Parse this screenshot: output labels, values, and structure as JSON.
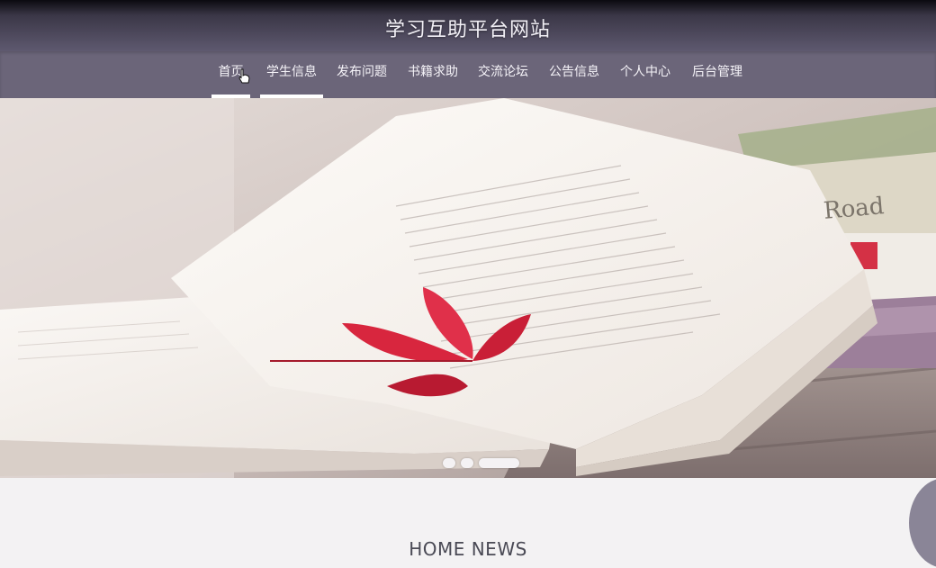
{
  "site": {
    "title": "学习互助平台网站"
  },
  "nav": {
    "items": [
      {
        "label": "首页"
      },
      {
        "label": "学生信息"
      },
      {
        "label": "发布问题"
      },
      {
        "label": "书籍求助"
      },
      {
        "label": "交流论坛"
      },
      {
        "label": "公告信息"
      },
      {
        "label": "个人中心"
      },
      {
        "label": "后台管理"
      }
    ],
    "active_index": 0
  },
  "banner": {
    "image": "open-book-with-red-leaf",
    "book_spine_text": "Road",
    "slides": 3,
    "current_slide": 3
  },
  "section": {
    "heading": "HOME NEWS"
  },
  "colors": {
    "header_dark": "#0b0a10",
    "nav_bg": "#6b6579",
    "page_bg": "#f3f2f3",
    "leaf_red": "#d8263e"
  }
}
